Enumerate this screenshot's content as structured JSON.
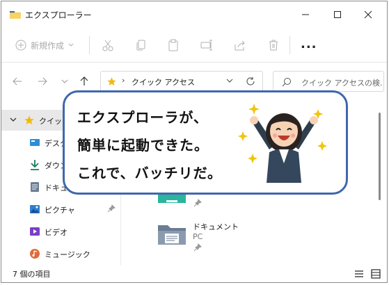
{
  "window": {
    "title": "エクスプローラー"
  },
  "toolbar": {
    "new_label": "新規作成",
    "more_label": "..."
  },
  "address": {
    "path": "クイック アクセス"
  },
  "search": {
    "placeholder": "クイック アクセスの検..."
  },
  "sidebar": {
    "items": [
      {
        "label": "クイック",
        "icon": "star-icon"
      },
      {
        "label": "デスク",
        "icon": "desktop-icon"
      },
      {
        "label": "ダウン",
        "icon": "download-icon"
      },
      {
        "label": "ドキュ",
        "icon": "document-icon"
      },
      {
        "label": "ピクチャ",
        "icon": "picture-icon"
      },
      {
        "label": "ビデオ",
        "icon": "video-icon"
      },
      {
        "label": "ミュージック",
        "icon": "music-icon"
      }
    ]
  },
  "main": {
    "document_folder": {
      "label": "ドキュメント",
      "sub": "PC"
    }
  },
  "status": {
    "text": "7 個の項目"
  },
  "callout": {
    "lines": [
      "エクスプローラが、",
      "簡単に起動できた。",
      "これで、バッチリだ。"
    ]
  },
  "colors": {
    "callout_border": "#3f67ad",
    "folder_yellow": "#f5c242",
    "accent_blue": "#0067c0"
  }
}
